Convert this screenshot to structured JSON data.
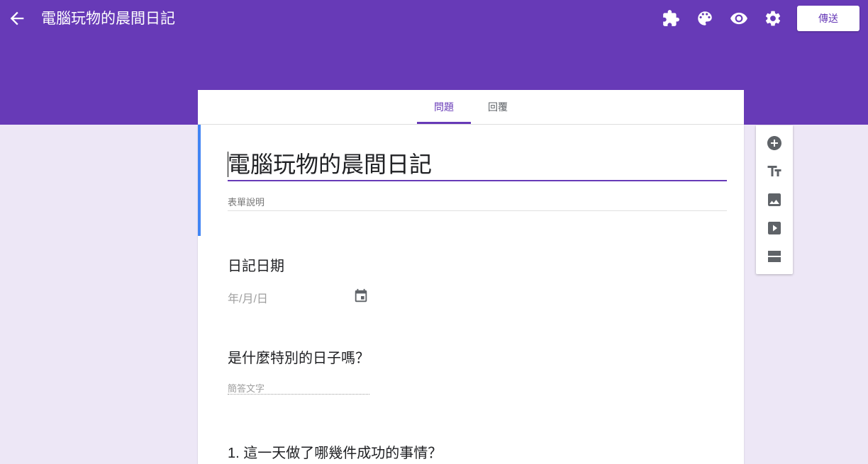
{
  "header": {
    "title": "電腦玩物的晨間日記",
    "send_label": "傳送",
    "icons": [
      "back-arrow-icon",
      "puzzle-addon-icon",
      "palette-icon",
      "eye-preview-icon",
      "gear-settings-icon"
    ],
    "bg_color": "#673ab7"
  },
  "tabs": [
    {
      "label": "問題",
      "active": true
    },
    {
      "label": "回覆",
      "active": false
    }
  ],
  "form": {
    "title": "電腦玩物的晨間日記",
    "description_placeholder": "表單說明"
  },
  "questions": [
    {
      "title": "日記日期",
      "type": "date",
      "placeholder": "年/月/日"
    },
    {
      "title": "是什麼特別的日子嗎？",
      "type": "short-answer",
      "placeholder": "簡答文字"
    },
    {
      "title": "1. 這一天做了哪幾件成功的事情？"
    }
  ],
  "toolbar": [
    "add-question-icon",
    "add-title-icon",
    "add-image-icon",
    "add-video-icon",
    "add-section-icon"
  ],
  "colors": {
    "accent": "#673ab7",
    "page_bg": "#ede7f6",
    "title_focus_border": "#4285f4"
  }
}
